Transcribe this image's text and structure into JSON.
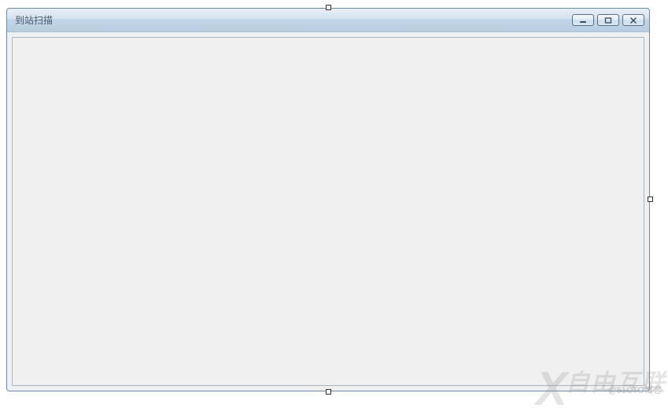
{
  "window": {
    "title": "到站扫描"
  },
  "watermark": {
    "logo_letter": "X",
    "logo_text": "自由互联",
    "sub": "@51CTO博客"
  }
}
